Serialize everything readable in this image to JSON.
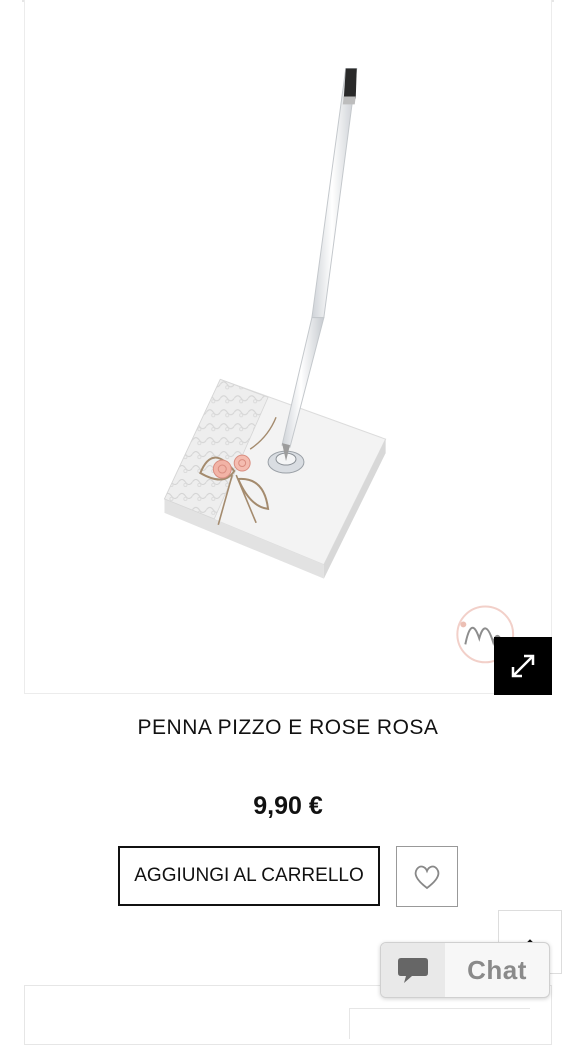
{
  "product": {
    "title": "PENNA PIZZO E ROSE ROSA",
    "price": "9,90 €",
    "image_alt": "Penna con base in pizzo e rose rosa"
  },
  "actions": {
    "add_to_cart_label": "AGGIUNGI AL CARRELLO",
    "wishlist_icon": "heart-icon",
    "expand_icon": "expand-icon",
    "back_to_top_icon": "chevron-up-icon"
  },
  "chat": {
    "label": "Chat",
    "icon": "speech-bubble-icon"
  },
  "colors": {
    "accent": "#000000",
    "text": "#111111",
    "rose": "#f2b3a6"
  }
}
